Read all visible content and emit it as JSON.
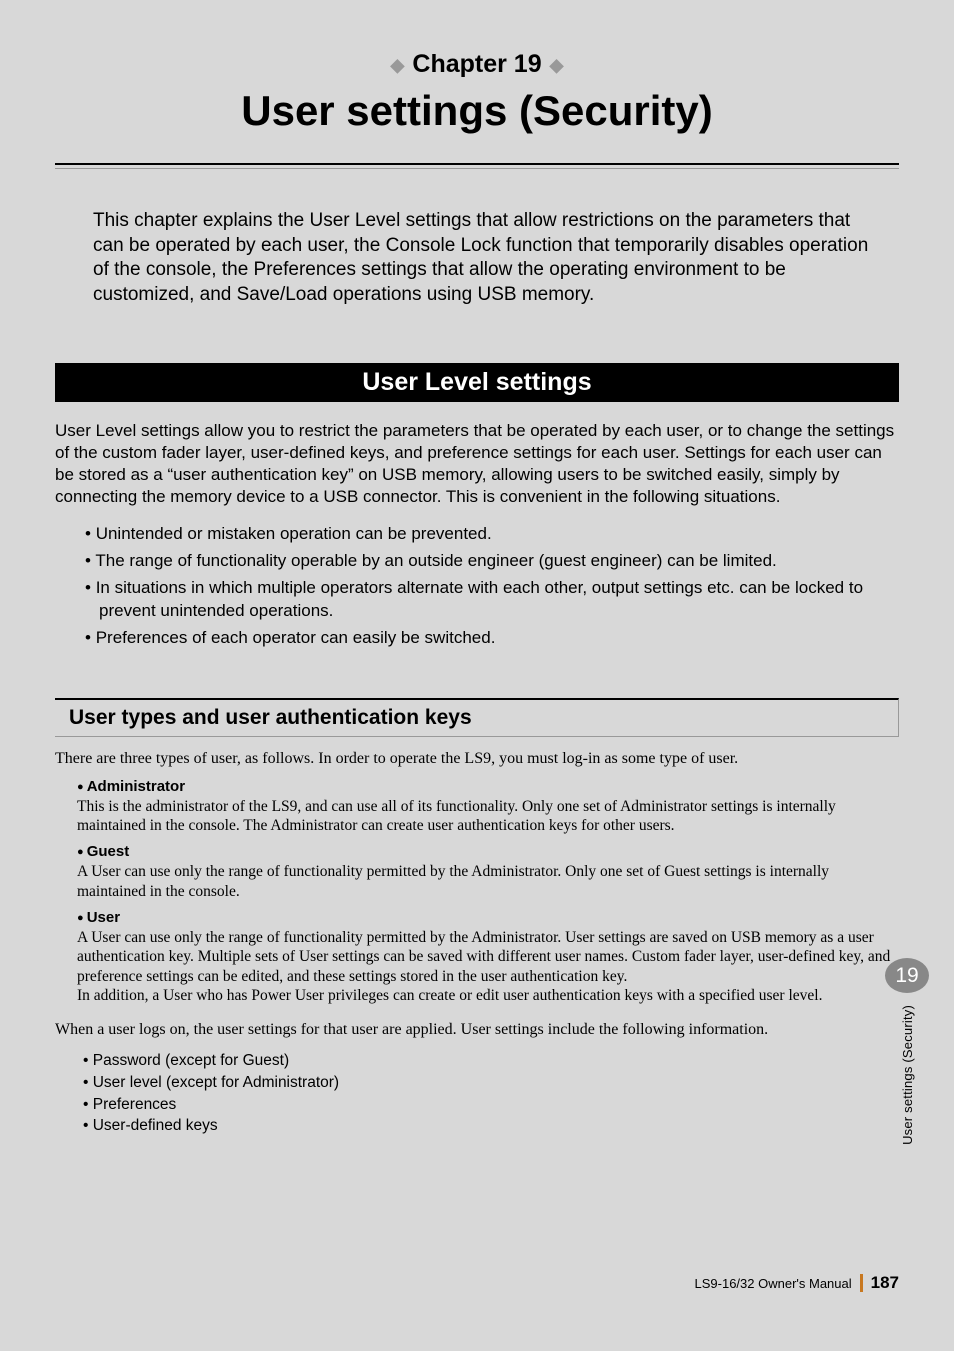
{
  "chapter": {
    "label": "Chapter 19",
    "title": "User settings (Security)"
  },
  "intro": "This chapter explains the User Level settings that allow restrictions on the parameters that can be operated by each user, the Console Lock function that temporarily disables operation of the console, the Preferences settings that allow the operating environment to be customized, and Save/Load operations using USB memory.",
  "section1": {
    "heading": "User Level settings",
    "intro": "User Level settings allow you to restrict the parameters that be operated by each user, or to change the settings of the custom fader layer, user-defined keys, and preference settings for each user. Settings for each user can be stored as a “user authentication key” on USB memory, allowing users to be switched easily, simply by connecting the memory device to a USB connector. This is convenient in the following situations.",
    "bullets": [
      "Unintended or mistaken operation can be prevented.",
      "The range of functionality operable by an outside engineer (guest engineer) can be limited.",
      "In situations in which multiple operators alternate with each other, output settings etc. can be locked to prevent unintended operations.",
      "Preferences of each operator can easily be switched."
    ]
  },
  "subsection": {
    "heading": "User types and user authentication keys",
    "intro": "There are three types of user, as follows. In order to operate the LS9, you must log-in as some type of user.",
    "types": [
      {
        "name": "Administrator",
        "desc": "This is the administrator of the LS9, and can use all of its functionality. Only one set of Administrator settings is internally maintained in the console. The Administrator can create user authentication keys for other users."
      },
      {
        "name": "Guest",
        "desc": "A User can use only the range of functionality permitted by the Administrator. Only one set of Guest settings is internally maintained in the console."
      },
      {
        "name": "User",
        "desc": "A User can use only the range of functionality permitted by the Administrator. User settings are saved on USB memory as a user authentication key. Multiple sets of User settings can be saved with different user names. Custom fader layer, user-defined key, and preference settings can be edited, and these settings stored in the user authentication key.\nIn addition, a User who has Power User privileges can create or edit user authentication keys with a specified user level."
      }
    ],
    "after": "When a user logs on, the user settings for that user are applied. User settings include the following information.",
    "bullets2": [
      "Password (except for Guest)",
      "User level (except for Administrator)",
      "Preferences",
      "User-defined keys"
    ]
  },
  "tab": {
    "number": "19",
    "text": "User settings (Security)"
  },
  "footer": {
    "manual": "LS9-16/32  Owner's Manual",
    "page": "187"
  }
}
